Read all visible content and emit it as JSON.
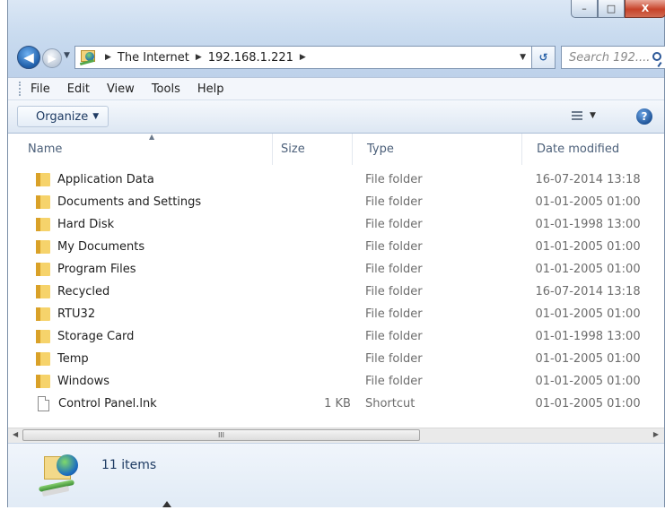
{
  "window": {
    "caption": {
      "minimize": "–",
      "maximize": "□",
      "close": "X"
    }
  },
  "nav": {
    "breadcrumbs": [
      "The Internet",
      "192.168.1.221"
    ],
    "search_placeholder": "Search 192...."
  },
  "menu": [
    "File",
    "Edit",
    "View",
    "Tools",
    "Help"
  ],
  "command_bar": {
    "organize_label": "Organize"
  },
  "columns": {
    "name": "Name",
    "size": "Size",
    "type": "Type",
    "date": "Date modified"
  },
  "files": [
    {
      "name": "Application Data",
      "size": "",
      "type": "File folder",
      "date": "16-07-2014 13:18",
      "icon": "folder-icon"
    },
    {
      "name": "Documents and Settings",
      "size": "",
      "type": "File folder",
      "date": "01-01-2005 01:00",
      "icon": "folder-icon"
    },
    {
      "name": "Hard Disk",
      "size": "",
      "type": "File folder",
      "date": "01-01-1998 13:00",
      "icon": "folder-icon"
    },
    {
      "name": "My Documents",
      "size": "",
      "type": "File folder",
      "date": "01-01-2005 01:00",
      "icon": "folder-icon"
    },
    {
      "name": "Program Files",
      "size": "",
      "type": "File folder",
      "date": "01-01-2005 01:00",
      "icon": "folder-icon"
    },
    {
      "name": "Recycled",
      "size": "",
      "type": "File folder",
      "date": "16-07-2014 13:18",
      "icon": "folder-icon"
    },
    {
      "name": "RTU32",
      "size": "",
      "type": "File folder",
      "date": "01-01-2005 01:00",
      "icon": "folder-icon"
    },
    {
      "name": "Storage Card",
      "size": "",
      "type": "File folder",
      "date": "01-01-1998 13:00",
      "icon": "folder-icon"
    },
    {
      "name": "Temp",
      "size": "",
      "type": "File folder",
      "date": "01-01-2005 01:00",
      "icon": "folder-icon"
    },
    {
      "name": "Windows",
      "size": "",
      "type": "File folder",
      "date": "01-01-2005 01:00",
      "icon": "folder-icon"
    },
    {
      "name": "Control Panel.lnk",
      "size": "1 KB",
      "type": "Shortcut",
      "date": "01-01-2005 01:00",
      "icon": "file-icon"
    }
  ],
  "status": {
    "item_count": "11 items"
  },
  "scrollbar": {
    "thumb_grip": "III"
  },
  "colors": {
    "window_frame": "#c7d8ec",
    "close_button": "#c7432a",
    "link_text": "#1e3b63"
  }
}
